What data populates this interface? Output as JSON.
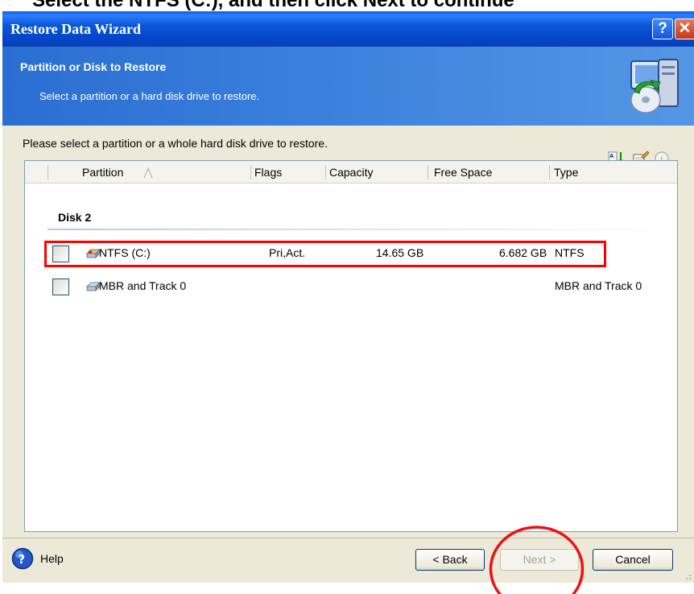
{
  "caption": {
    "text": "Select the NTFS (C:), and then click Next to continue"
  },
  "window": {
    "title": "Restore Data Wizard",
    "help_button": "?",
    "close_button": "✕"
  },
  "header": {
    "title": "Partition or Disk to Restore",
    "subtitle": "Select a partition or a hard disk drive to restore."
  },
  "content": {
    "instruction": "Please select a partition or a whole hard disk drive to restore.",
    "toolbar_icons": [
      "sort-icon",
      "properties-icon",
      "info-icon"
    ]
  },
  "table": {
    "columns": {
      "partition": "Partition",
      "flags": "Flags",
      "capacity": "Capacity",
      "free_space": "Free Space",
      "type": "Type"
    },
    "group": "Disk 2",
    "rows": [
      {
        "partition": "NTFS (C:)",
        "flags": "Pri,Act.",
        "capacity": "14.65 GB",
        "free_space": "6.682 GB",
        "type": "NTFS",
        "checked": false,
        "highlighted": true
      },
      {
        "partition": "MBR and Track 0",
        "flags": "",
        "capacity": "",
        "free_space": "",
        "type": "MBR and Track 0",
        "checked": false,
        "highlighted": false
      }
    ]
  },
  "footer": {
    "help_label": "Help",
    "back_label": "< Back",
    "next_label": "Next >",
    "cancel_label": "Cancel",
    "next_enabled": false
  },
  "colors": {
    "title_bar": "#0a56d8",
    "header_banner": "#3a80dc",
    "window_face": "#ece9d8",
    "annotation": "#ff0000"
  }
}
